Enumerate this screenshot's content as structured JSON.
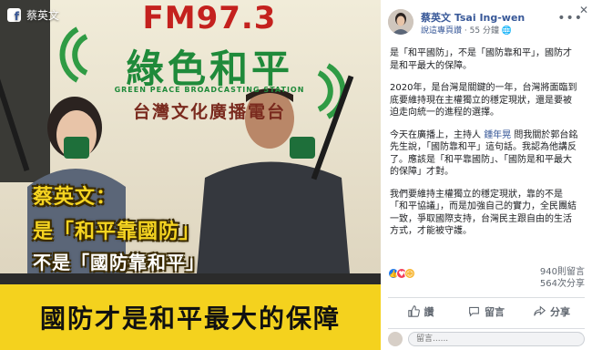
{
  "photo": {
    "owner_name": "蔡英文",
    "station_freq": "FM97.3",
    "station_name": "綠色和平",
    "station_en": "GREEN PEACE BROADCASTING STATION",
    "station_zh": "台灣文化廣播電台",
    "caption_line1": "蔡英文：",
    "caption_line2": "是「和平靠國防」",
    "caption_line3": "不是「國防靠和平」",
    "banner": "國防才是和平最大的保障",
    "colors": {
      "banner": "#f4d21e",
      "caption": "#f5d421",
      "station_red": "#c4211e",
      "station_green": "#1f8a3a"
    }
  },
  "post": {
    "author": "蔡英文 Tsai Ing-wen",
    "meta_link": "說這專頁讚",
    "meta_time": "55 分鐘",
    "paragraphs": [
      "是「和平國防」，不是「國防靠和平」，國防才是和平最大的保障。",
      "2020年，是台灣是關鍵的一年，台灣將面臨到底要維持現在主權獨立的穩定現狀，還是要被迫走向統一的進程的選擇。",
      "今天在廣播上，主持人 鍾年晃 問我關於郭台銘先生說，「國防靠和平」這句話。我認為他講反了。應該是「和平靠國防」、「國防是和平最大的保障」才對。",
      "我們要維持主權獨立的穩定現狀，靠的不是「和平協議」，而是加強自己的實力，全民團結一致，爭取國際支持，台灣民主跟自由的生活方式，才能被守護。"
    ],
    "mention": "鍾年晃",
    "reactions_icons": [
      "like-icon",
      "love-icon",
      "haha-icon"
    ],
    "reaction_count": "940則留言",
    "share_count": "564次分享",
    "actions": {
      "like": "讚",
      "comment": "留言",
      "share": "分享"
    },
    "comment_placeholder": "留言......",
    "colors": {
      "link": "#385898",
      "like": "#1877f2",
      "love": "#f33e58",
      "haha": "#f7b125"
    }
  }
}
